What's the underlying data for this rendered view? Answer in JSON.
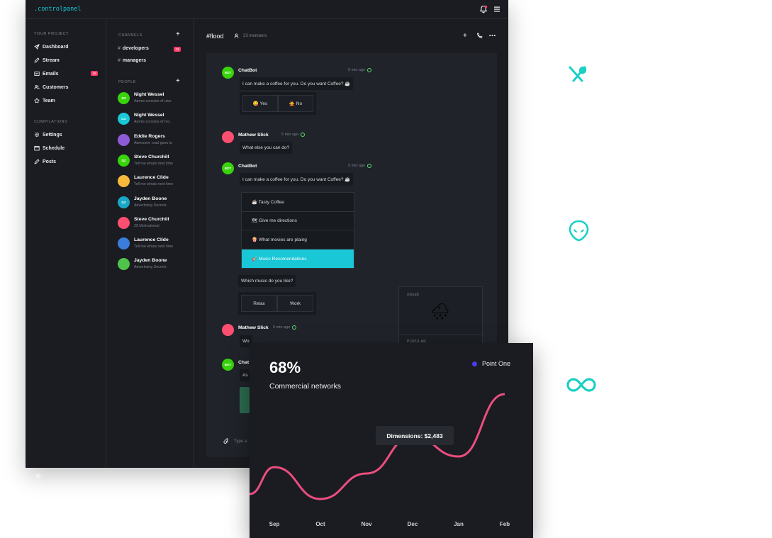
{
  "app": {
    "logo": ".controlpanel"
  },
  "sidebar": {
    "project_label": "YOUR PROJECT",
    "items": [
      {
        "label": "Dashboard",
        "icon": "send-icon"
      },
      {
        "label": "Stream",
        "icon": "pencil-icon"
      },
      {
        "label": "Emails",
        "icon": "mail-icon",
        "badge": "16"
      },
      {
        "label": "Customers",
        "icon": "users-icon"
      },
      {
        "label": "Team",
        "icon": "star-icon"
      }
    ],
    "compilations_label": "COMPILATIONS",
    "compilations": [
      {
        "label": "Settings",
        "icon": "gear-icon"
      },
      {
        "label": "Schedule",
        "icon": "calendar-icon"
      },
      {
        "label": "Posts",
        "icon": "pencil-icon"
      }
    ]
  },
  "channels": {
    "label": "CHANNELS",
    "items": [
      {
        "name": "developers",
        "badge": "22"
      },
      {
        "name": "managers"
      }
    ]
  },
  "people": {
    "label": "PEOPLE",
    "items": [
      {
        "name": "Night Wessel",
        "sub": "Atoms consists of ules",
        "initials": "DZ",
        "color": "#38d30b"
      },
      {
        "name": "Night Wessel",
        "sub": "Atoms consists of mo..",
        "initials": "LG",
        "color": "#19c7d6"
      },
      {
        "name": "Eddie Rogers",
        "sub": "Awesome road goes to",
        "initials": "",
        "color": "#8e5bd6"
      },
      {
        "name": "Steve Churchill",
        "sub": "Tell me whats next time",
        "initials": "DZ",
        "color": "#38d30b"
      },
      {
        "name": "Laurence Clide",
        "sub": "Tell me whats next time",
        "initials": "",
        "color": "#f6b93b"
      },
      {
        "name": "Jayden Boone",
        "sub": "Advertising Secrets",
        "initials": "DZ",
        "color": "#19a7c6"
      },
      {
        "name": "Steve Churchill",
        "sub": "29 Motivational",
        "initials": "",
        "color": "#ff4f70"
      },
      {
        "name": "Laurence Clide",
        "sub": "Tell me whats next time",
        "initials": "",
        "color": "#3b7ddd"
      },
      {
        "name": "Jayden Boone",
        "sub": "Advertising Secrets",
        "initials": "",
        "color": "#4fc34a"
      }
    ]
  },
  "chat": {
    "title": "#flood",
    "members": "23 members",
    "messages": [
      {
        "name": "ChatBot",
        "time": "5 min ago",
        "text": "I can make a coffee for you. Do you want Coffee? ☕"
      },
      {
        "name": "Mathew Slick",
        "time": "5 min ago",
        "text": "What else you can do?"
      },
      {
        "name": "ChatBot",
        "time": "5 min ago",
        "text": "I can make a coffee for you. Do you want Coffee? ☕"
      },
      {
        "name": "Mathew Slick",
        "time": "5 min ago",
        "text": "Wo"
      },
      {
        "name": "Chat",
        "text": "As"
      }
    ],
    "bot_initials": "BOT",
    "yes_no": [
      "😋 Yes",
      "🙅 No"
    ],
    "options": [
      "☕ Tasty Coffee",
      "🗺 Give me directions",
      "🍿 What movies are plaing",
      "🎸 Music Recomendations"
    ],
    "music_question": "Which music do you like?",
    "music_choices": [
      "Relax",
      "Work"
    ],
    "cloud_tag": "(cloud)",
    "cloud_emoji": "🌧",
    "popular_label": "POPULAR",
    "type_placeholder": "Type a"
  },
  "chart": {
    "percent": "68%",
    "subtitle": "Commercial networks",
    "tooltip": "Dimensions: $2,483",
    "accent": "#ec4d7f",
    "legend_color": "#4b3df0"
  },
  "chart_data": {
    "type": "line",
    "categories": [
      "Sep",
      "Oct",
      "Nov",
      "Dec",
      "Jan",
      "Feb"
    ],
    "series": [
      {
        "name": "Point One",
        "values": [
          2050,
          1600,
          1960,
          2483,
          2200,
          3080
        ]
      }
    ],
    "highlight": {
      "category": "Dec",
      "value": 2483
    },
    "ylim": [
      1200,
      3200
    ]
  },
  "decor": {
    "accent": "#1ad0c4",
    "icons": [
      "utensils-icon",
      "alien-icon",
      "infinity-icon"
    ]
  }
}
